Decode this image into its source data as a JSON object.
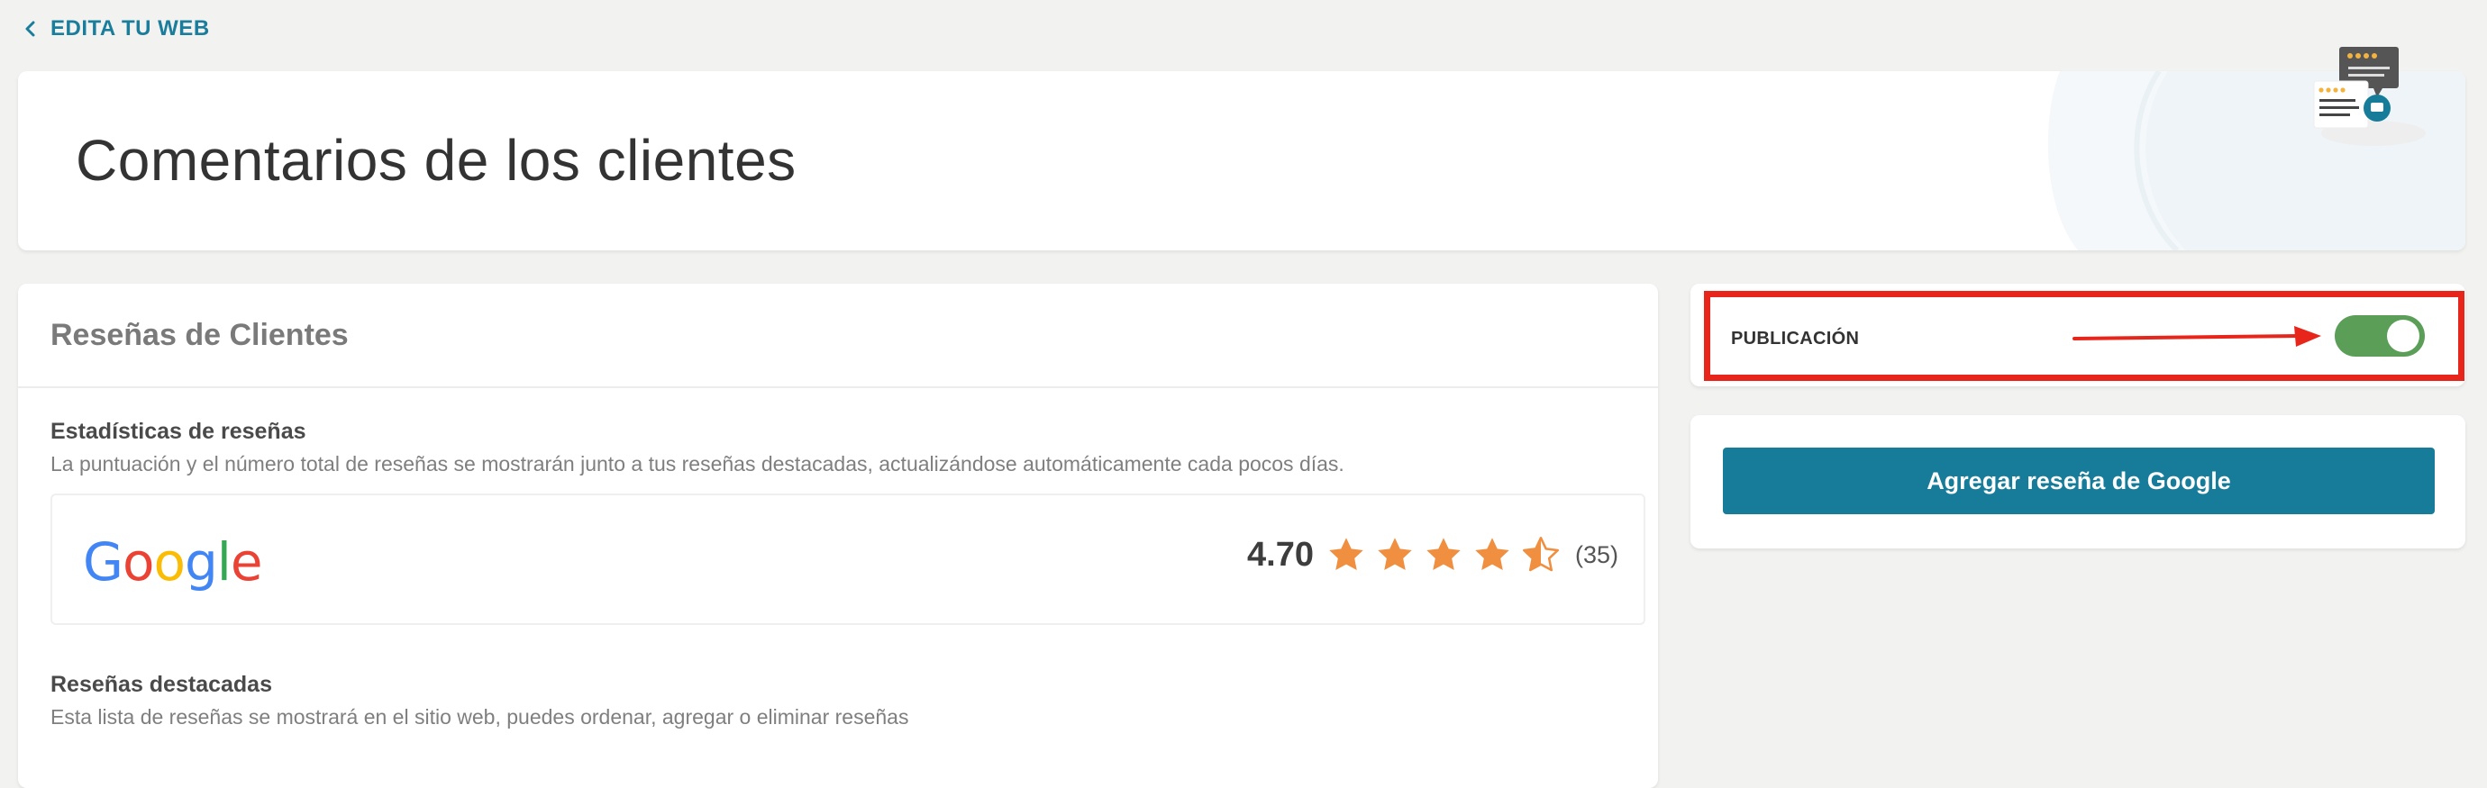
{
  "nav": {
    "back_label": "EDITA TU WEB"
  },
  "header": {
    "title": "Comentarios de los clientes"
  },
  "reviews": {
    "card_title": "Reseñas de Clientes",
    "stats": {
      "heading": "Estadísticas de reseñas",
      "description": "La puntuación y el número total de reseñas se mostrarán junto a tus reseñas destacadas, actualizándose automáticamente cada pocos días.",
      "provider_logo": "Google",
      "score": "4.70",
      "rating_value": 4.7,
      "rating_max": 5,
      "count": "(35)"
    },
    "featured": {
      "heading": "Reseñas destacadas",
      "description": "Esta lista de reseñas se mostrará en el sitio web, puedes ordenar, agregar o eliminar reseñas"
    }
  },
  "publication": {
    "label": "PUBLICACIÓN",
    "enabled": true
  },
  "actions": {
    "add_google_review_label": "Agregar reseña de Google"
  },
  "colors": {
    "accent": "#167c99",
    "link": "#1a7d9c",
    "toggle_on": "#5b9e57",
    "star": "#ef8f3f",
    "highlight": "#e8251a"
  },
  "icons": [
    "chevron-left-icon",
    "star-icon",
    "star-half-icon",
    "arrow-right-icon",
    "reviews-illustration-icon"
  ]
}
